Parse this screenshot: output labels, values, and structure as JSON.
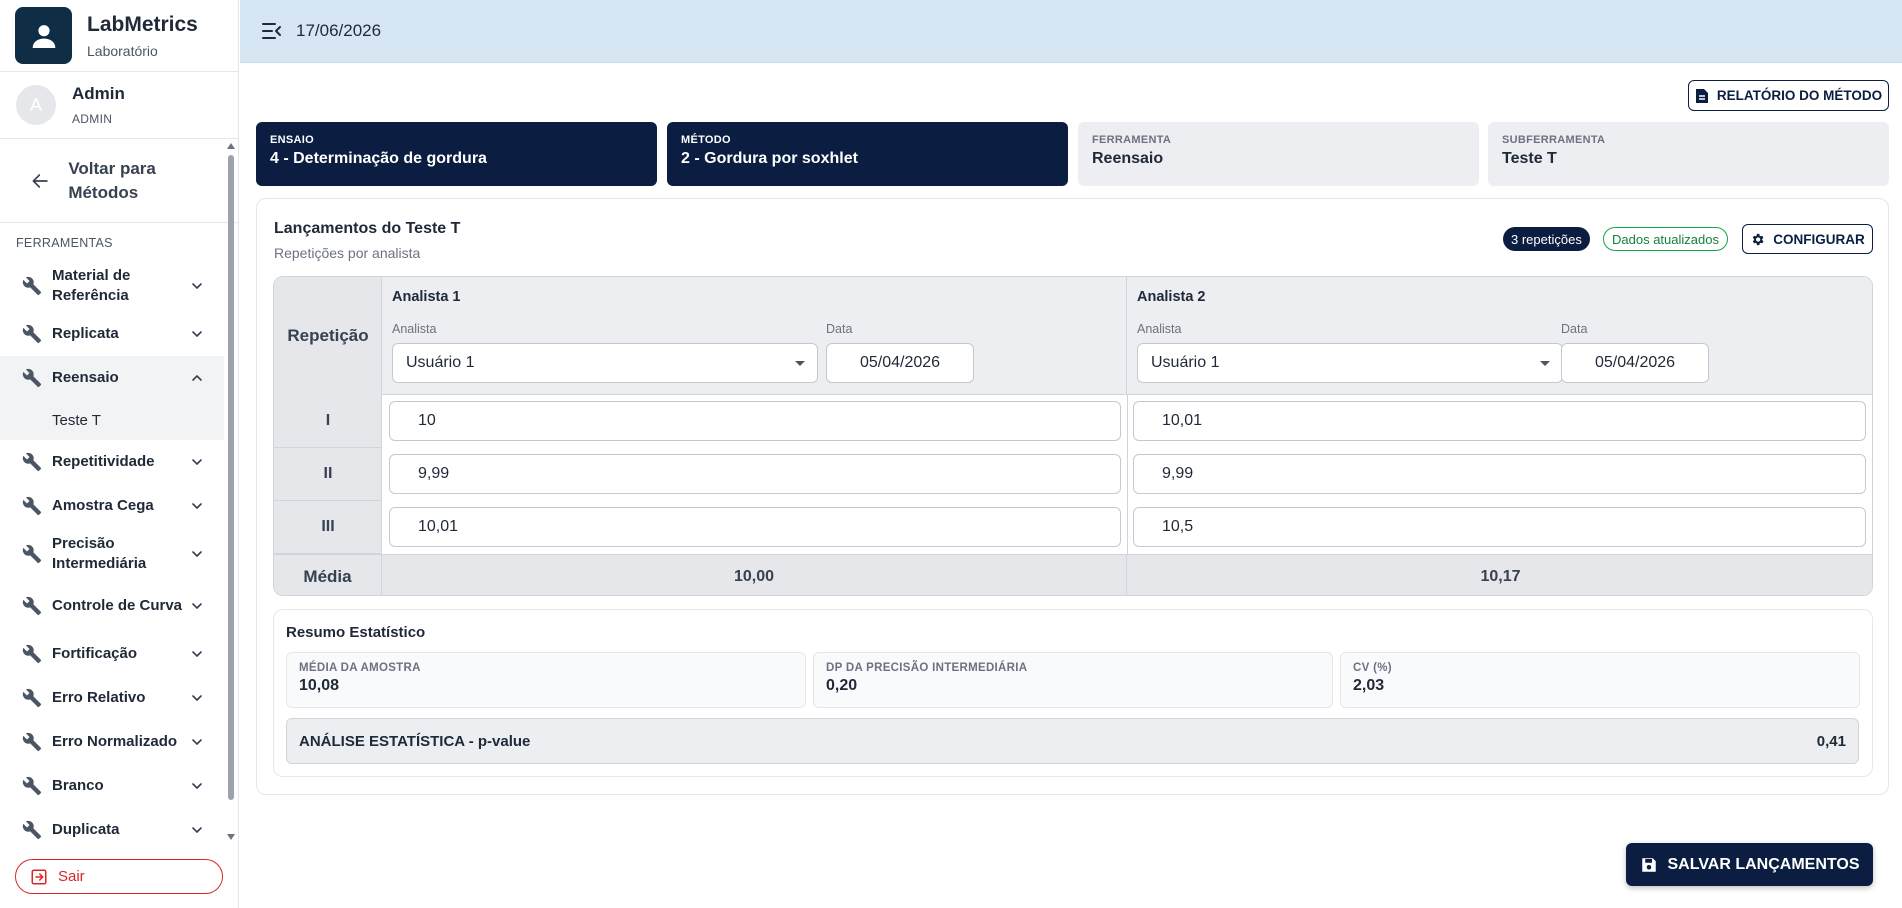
{
  "app": {
    "name": "LabMetrics",
    "subtitle": "Laboratório",
    "brand_icon": "person-icon"
  },
  "user": {
    "initial": "A",
    "name": "Admin",
    "role": "ADMIN"
  },
  "nav": {
    "back_label": "Voltar para Métodos",
    "section_label": "FERRAMENTAS",
    "items": [
      {
        "label": "Material de Referência",
        "expanded": false
      },
      {
        "label": "Replicata",
        "expanded": false
      },
      {
        "label": "Reensaio",
        "expanded": true,
        "active": true,
        "children": [
          {
            "label": "Teste T"
          }
        ]
      },
      {
        "label": "Repetitividade",
        "expanded": false
      },
      {
        "label": "Amostra Cega",
        "expanded": false
      },
      {
        "label": "Precisão Intermediária",
        "expanded": false
      },
      {
        "label": "Controle de Curva",
        "expanded": false
      },
      {
        "label": "Fortificação",
        "expanded": false
      },
      {
        "label": "Erro Relativo",
        "expanded": false
      },
      {
        "label": "Erro Normalizado",
        "expanded": false
      },
      {
        "label": "Branco",
        "expanded": false
      },
      {
        "label": "Duplicata",
        "expanded": false
      }
    ],
    "logout_label": "Sair"
  },
  "topbar": {
    "date": "17/06/2026"
  },
  "report_button": "RELATÓRIO DO MÉTODO",
  "info_cards": [
    {
      "key": "ENSAIO",
      "value": "4 - Determinação de gordura"
    },
    {
      "key": "MÉTODO",
      "value": "2 - Gordura por soxhlet"
    },
    {
      "key": "FERRAMENTA",
      "value": "Reensaio"
    },
    {
      "key": "SUBFERRAMENTA",
      "value": "Teste T"
    }
  ],
  "panel": {
    "title": "Lançamentos do Teste T",
    "subtitle": "Repetições por analista",
    "repetitions_badge": "3 repetições",
    "status_badge": "Dados atualizados",
    "config_button": "CONFIGURAR"
  },
  "grid": {
    "rep_header": "Repetição",
    "analyst_field_label": "Analista",
    "date_field_label": "Data",
    "analysts": [
      {
        "title": "Analista 1",
        "analyst": "Usuário 1",
        "date": "05/04/2026",
        "values": [
          "10",
          "9,99",
          "10,01"
        ],
        "mean": "10,00"
      },
      {
        "title": "Analista 2",
        "analyst": "Usuário 1",
        "date": "05/04/2026",
        "values": [
          "10,01",
          "9,99",
          "10,5"
        ],
        "mean": "10,17"
      }
    ],
    "rows": [
      "I",
      "II",
      "III"
    ],
    "mean_label": "Média"
  },
  "stats": {
    "title": "Resumo Estatístico",
    "cards": [
      {
        "key": "MÉDIA DA AMOSTRA",
        "value": "10,08"
      },
      {
        "key": "DP DA PRECISÃO INTERMEDIÁRIA",
        "value": "0,20"
      },
      {
        "key": "CV (%)",
        "value": "2,03"
      }
    ],
    "pvalue_label": "ANÁLISE ESTATÍSTICA - p-value",
    "pvalue": "0,41"
  },
  "save_button": "SALVAR LANÇAMENTOS",
  "colors": {
    "navy": "#0b1e42",
    "topbar": "#d6e6f3",
    "danger": "#dc2626",
    "success": "#16a34a"
  }
}
